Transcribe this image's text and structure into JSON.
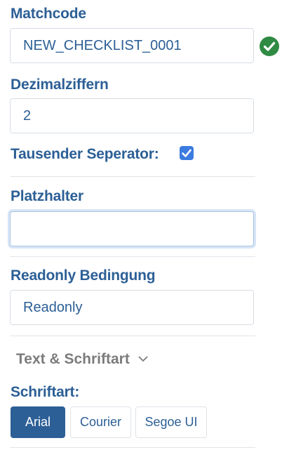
{
  "matchcode": {
    "label": "Matchcode",
    "value": "NEW_CHECKLIST_0001",
    "valid_icon": "check-circle-icon",
    "valid_color": "#2f8a43"
  },
  "dezimalziffern": {
    "label": "Dezimalziffern",
    "value": "2"
  },
  "tausender": {
    "label": "Tausender Seperator:",
    "checked": true,
    "color": "#3b7be0"
  },
  "platzhalter": {
    "label": "Platzhalter",
    "value": ""
  },
  "readonly": {
    "label": "Readonly Bedingung",
    "value": "Readonly"
  },
  "text_section": {
    "label": "Text & Schriftart",
    "icon": "chevron-down-icon"
  },
  "schriftart": {
    "label": "Schriftart:",
    "options": [
      "Arial",
      "Courier",
      "Segoe UI"
    ],
    "selected": "Arial"
  },
  "colors": {
    "primary": "#2c5f96",
    "muted": "#7c7c7c",
    "border": "#d7dde5"
  }
}
